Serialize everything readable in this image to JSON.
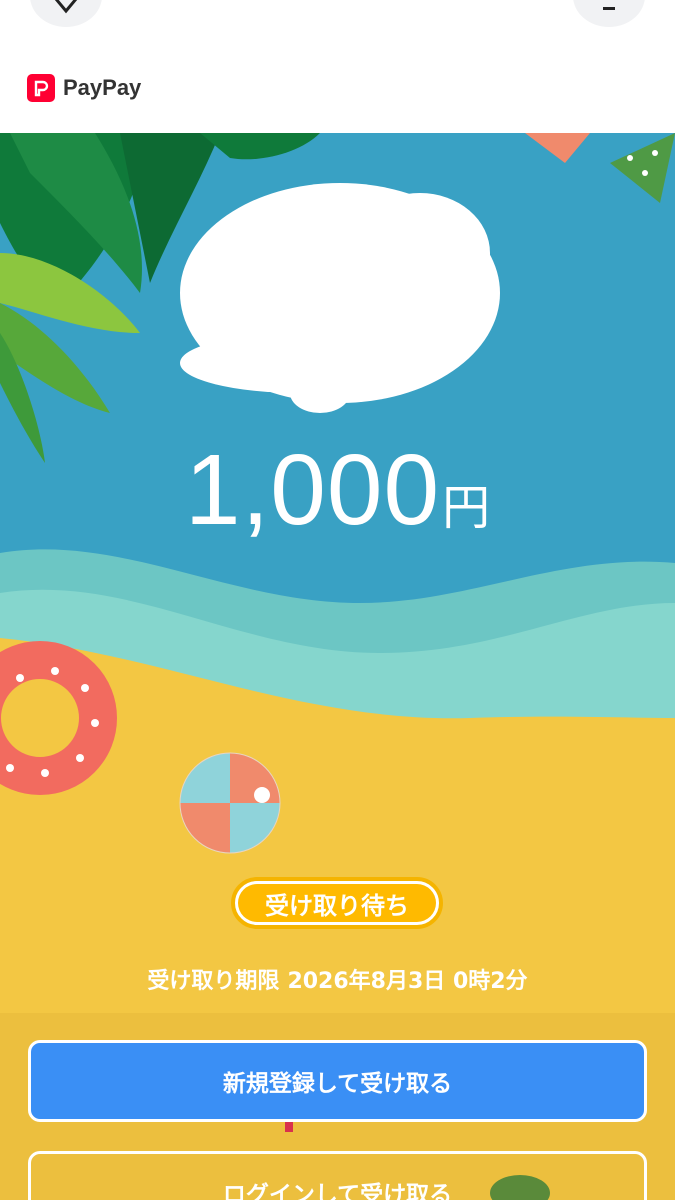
{
  "nav": {
    "title": "",
    "back_icon": "close-icon",
    "menu_icon": "menu-icon"
  },
  "brand": {
    "name": "PayPay",
    "color": "#ff0033"
  },
  "card": {
    "amount_value": "1,000",
    "amount_unit": "円",
    "status_label": "受け取り待ち",
    "deadline_label": "受け取り期限",
    "deadline_value": "2026年8月3日 0時2分"
  },
  "actions": {
    "register_label": "新規登録して受け取る",
    "login_label": "ログインして受け取る"
  },
  "colors": {
    "sky": "#39a1c4",
    "sea": "#74cfc8",
    "sand": "#f3c743",
    "primary_button": "#3a8ff5",
    "status_badge": "#ffba00"
  }
}
